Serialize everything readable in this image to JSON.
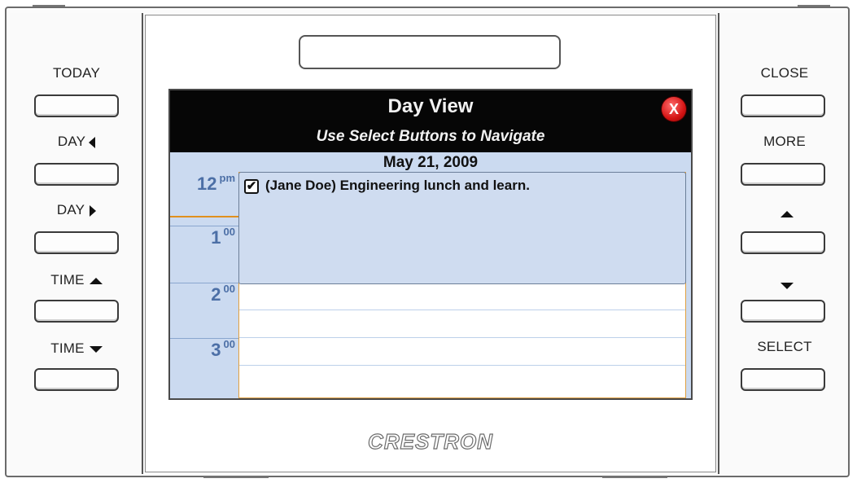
{
  "left_panel": {
    "buttons": [
      {
        "label": "TODAY",
        "arrow": ""
      },
      {
        "label": "DAY",
        "arrow": "left-triangle-icon"
      },
      {
        "label": "DAY",
        "arrow": "right-triangle-icon"
      },
      {
        "label": "TIME",
        "arrow": "up-triangle-icon"
      },
      {
        "label": "TIME",
        "arrow": "down-triangle-icon"
      }
    ]
  },
  "right_panel": {
    "buttons": [
      {
        "label": "CLOSE",
        "arrow": ""
      },
      {
        "label": "MORE",
        "arrow": ""
      },
      {
        "label": "",
        "arrow": "up-triangle-icon"
      },
      {
        "label": "",
        "arrow": "down-triangle-icon"
      },
      {
        "label": "SELECT",
        "arrow": ""
      }
    ]
  },
  "screen": {
    "title": "Day View",
    "subtitle": "Use Select Buttons to Navigate",
    "close_label": "X",
    "date": "May 21, 2009",
    "times": [
      {
        "hour": "12",
        "suffix": "pm"
      },
      {
        "hour": "1",
        "suffix": "00"
      },
      {
        "hour": "2",
        "suffix": "00"
      },
      {
        "hour": "3",
        "suffix": "00"
      }
    ],
    "event": {
      "checkbox": "✔",
      "text": "(Jane Doe) Engineering lunch and learn."
    }
  },
  "brand": "CRESTRON",
  "colors": {
    "screen_bg": "#cbdaf0",
    "titlebar": "#060606",
    "time_text": "#4c6fa6",
    "accent_orange": "#e0901e",
    "close_red": "#d41414"
  }
}
